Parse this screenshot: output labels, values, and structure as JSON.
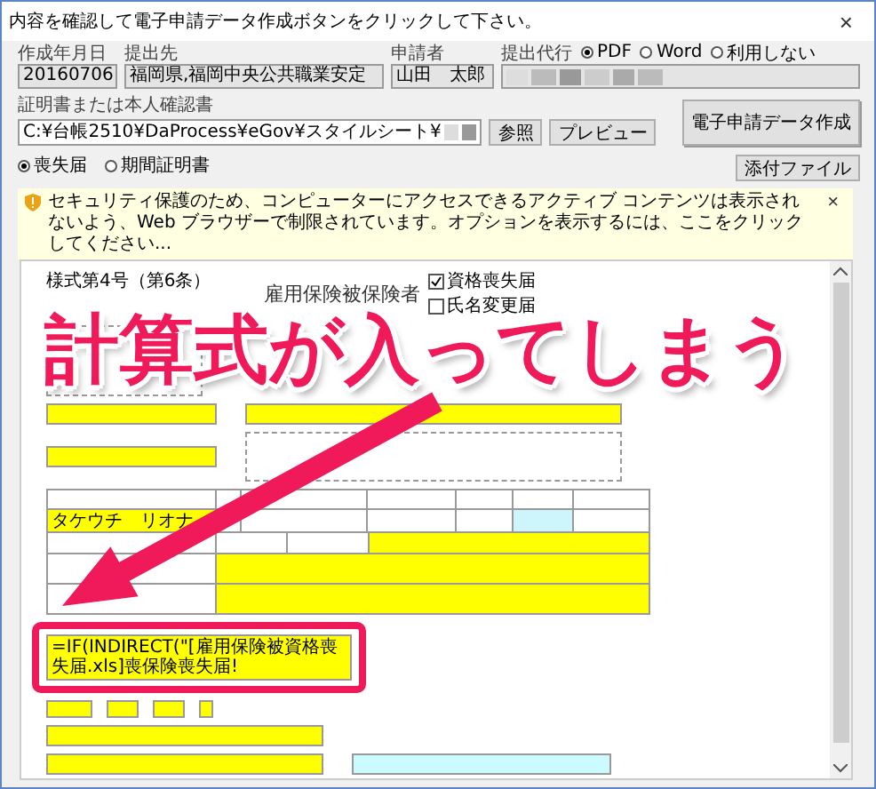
{
  "window": {
    "title": "内容を確認して電子申請データ作成ボタンをクリックして下さい。",
    "close": "×"
  },
  "header": {
    "fields": [
      {
        "label": "作成年月日",
        "value": "20160706"
      },
      {
        "label": "提出先",
        "value": "福岡県,福岡中央公共職業安定"
      },
      {
        "label": "申請者",
        "value": "山田　太郎"
      }
    ],
    "agent": {
      "label": "提出代行",
      "options": [
        {
          "label": "PDF",
          "selected": true
        },
        {
          "label": "Word",
          "selected": false
        },
        {
          "label": "利用しない",
          "selected": false
        }
      ]
    },
    "create_button": "電子申請データ作成"
  },
  "attachment": {
    "label": "証明書または本人確認書",
    "path": "C:¥台帳2510¥DaProcess¥eGov¥スタイルシート¥",
    "buttons": [
      "参照",
      "プレビュー"
    ],
    "attach_button": "添付ファイル"
  },
  "doc_type": [
    {
      "label": "喪失届",
      "selected": true
    },
    {
      "label": "期間証明書",
      "selected": false
    }
  ],
  "info_bar": {
    "text": "セキュリティ保護のため、コンピューターにアクセスできるアクティブ コンテンツは表示されないよう、Web ブラウザーで制限されています。オプションを表示するには、ここをクリックしてください...",
    "close": "×"
  },
  "form": {
    "title": "様式第4号（第6条）",
    "heading": "雇用保険被保険者",
    "checks": [
      {
        "label": "資格喪失届",
        "checked": true
      },
      {
        "label": "氏名変更届",
        "checked": false
      }
    ],
    "name": "タケウチ　リオナ",
    "formula": "=IF(INDIRECT(\"[雇用保険被資格喪失届.xls]喪保険喪失届!"
  },
  "annotation": {
    "text": "計算式が入ってしまう"
  }
}
